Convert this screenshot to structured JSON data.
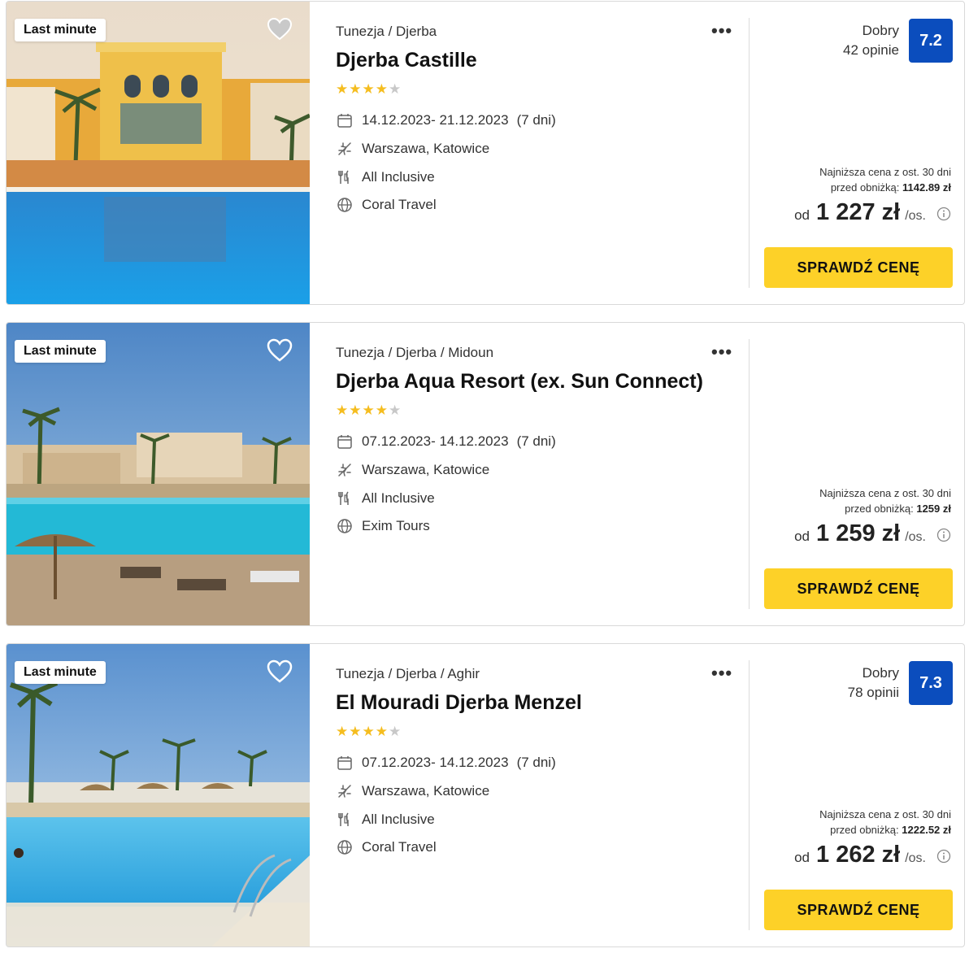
{
  "colors": {
    "accent_button": "#fdd128",
    "rating_box": "#0b4dbd",
    "star_on": "#f5bd1f",
    "star_off": "#c8c8c8"
  },
  "offers": [
    {
      "badge": "Last minute",
      "location": "Tunezja / Djerba",
      "name": "Djerba Castille",
      "stars_filled": 4,
      "stars_total": 5,
      "dates": "14.12.2023- 21.12.2023",
      "nights": "(7 dni)",
      "airports": "Warszawa, Katowice",
      "board": "All Inclusive",
      "operator": "Coral Travel",
      "rating_text": "Dobry",
      "reviews": "42 opinie",
      "rating": "7.2",
      "lowest_price_label_1": "Najniższa cena z ost. 30 dni",
      "lowest_price_label_2": "przed obniżką:",
      "lowest_price": "1142.89 zł",
      "price_prefix": "od",
      "price": "1 227 zł",
      "price_suffix": "/os.",
      "cta": "SPRAWDŹ CENĘ"
    },
    {
      "badge": "Last minute",
      "location": "Tunezja / Djerba / Midoun",
      "name": "Djerba Aqua Resort (ex. Sun Connect)",
      "stars_filled": 4,
      "stars_total": 5,
      "dates": "07.12.2023- 14.12.2023",
      "nights": "(7 dni)",
      "airports": "Warszawa, Katowice",
      "board": "All Inclusive",
      "operator": "Exim Tours",
      "lowest_price_label_1": "Najniższa cena z ost. 30 dni",
      "lowest_price_label_2": "przed obniżką:",
      "lowest_price": "1259 zł",
      "price_prefix": "od",
      "price": "1 259 zł",
      "price_suffix": "/os.",
      "cta": "SPRAWDŹ CENĘ"
    },
    {
      "badge": "Last minute",
      "location": "Tunezja / Djerba / Aghir",
      "name": "El Mouradi Djerba Menzel",
      "stars_filled": 4,
      "stars_total": 5,
      "dates": "07.12.2023- 14.12.2023",
      "nights": "(7 dni)",
      "airports": "Warszawa, Katowice",
      "board": "All Inclusive",
      "operator": "Coral Travel",
      "rating_text": "Dobry",
      "reviews": "78 opinii",
      "rating": "7.3",
      "lowest_price_label_1": "Najniższa cena z ost. 30 dni",
      "lowest_price_label_2": "przed obniżką:",
      "lowest_price": "1222.52 zł",
      "price_prefix": "od",
      "price": "1 262 zł",
      "price_suffix": "/os.",
      "cta": "SPRAWDŹ CENĘ"
    }
  ]
}
